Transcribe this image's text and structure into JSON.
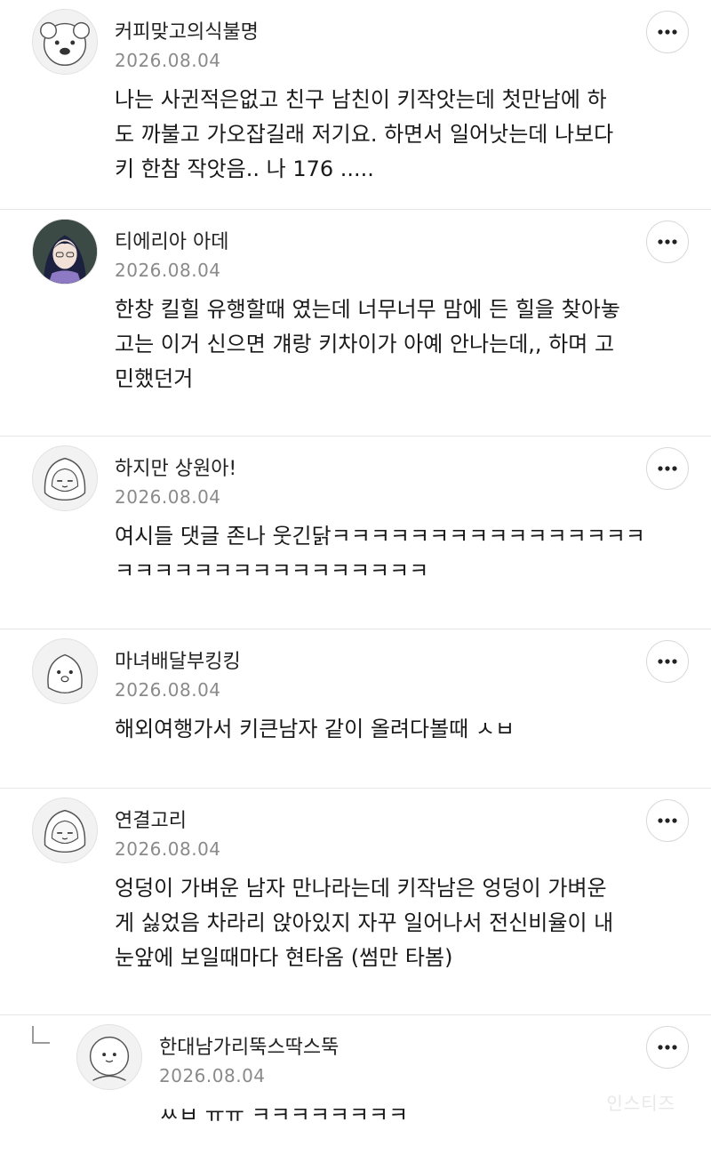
{
  "comments": [
    {
      "author": "커피맞고의식불명",
      "date": "2026.08.04",
      "text": "나는 사귄적은없고 친구 남친이 키작앗는데 첫만남에 하\n도 까불고 가오잡길래 저기요. 하면서 일어낫는데 나보다\n키 한참 작앗음.. 나 176 .....",
      "avatar": "dog-avatar"
    },
    {
      "author": "티에리아 아데",
      "date": "2026.08.04",
      "text": "한창 킬힐 유행할때 였는데 너무너무 맘에 든 힐을 찾아놓\n고는 이거 신으면 걔랑 키차이가 아예 안나는데,, 하며 고\n민했던거",
      "avatar": "anime-character-avatar"
    },
    {
      "author": "하지만 상원아!",
      "date": "2026.08.04",
      "text": "여시들 댓글 존나 웃긴닭ㅋㅋㅋㅋㅋㅋㅋㅋㅋㅋㅋㅋㅋㅋㅋㅋ\nㅋㅋㅋㅋㅋㅋㅋㅋㅋㅋㅋㅋㅋㅋㅋㅋ",
      "avatar": "hood-cat-avatar"
    },
    {
      "author": "마녀배달부킹킹",
      "date": "2026.08.04",
      "text": "해외여행가서 키큰남자 같이 올려다볼때 ㅅㅂ",
      "avatar": "blob-avatar"
    },
    {
      "author": "연결고리",
      "date": "2026.08.04",
      "text": "엉덩이 가벼운 남자 만나라는데 키작남은 엉덩이 가벼운\n게 싫었음 차라리 앉아있지 자꾸 일어나서 전신비율이 내\n눈앞에 보일때마다 현타옴 (썸만 타봄)",
      "avatar": "hood-cat-avatar"
    }
  ],
  "reply": {
    "author": "한대남가리뚝스딱스뚝",
    "date": "2026.08.04",
    "text": "ㅆㅂ ㅠㅠ ㅋㅋㅋㅋㅋㅋㅋㅋ",
    "avatar": "round-character-avatar"
  },
  "more_icon": "more-horizontal-icon",
  "watermark": "인스티즈"
}
